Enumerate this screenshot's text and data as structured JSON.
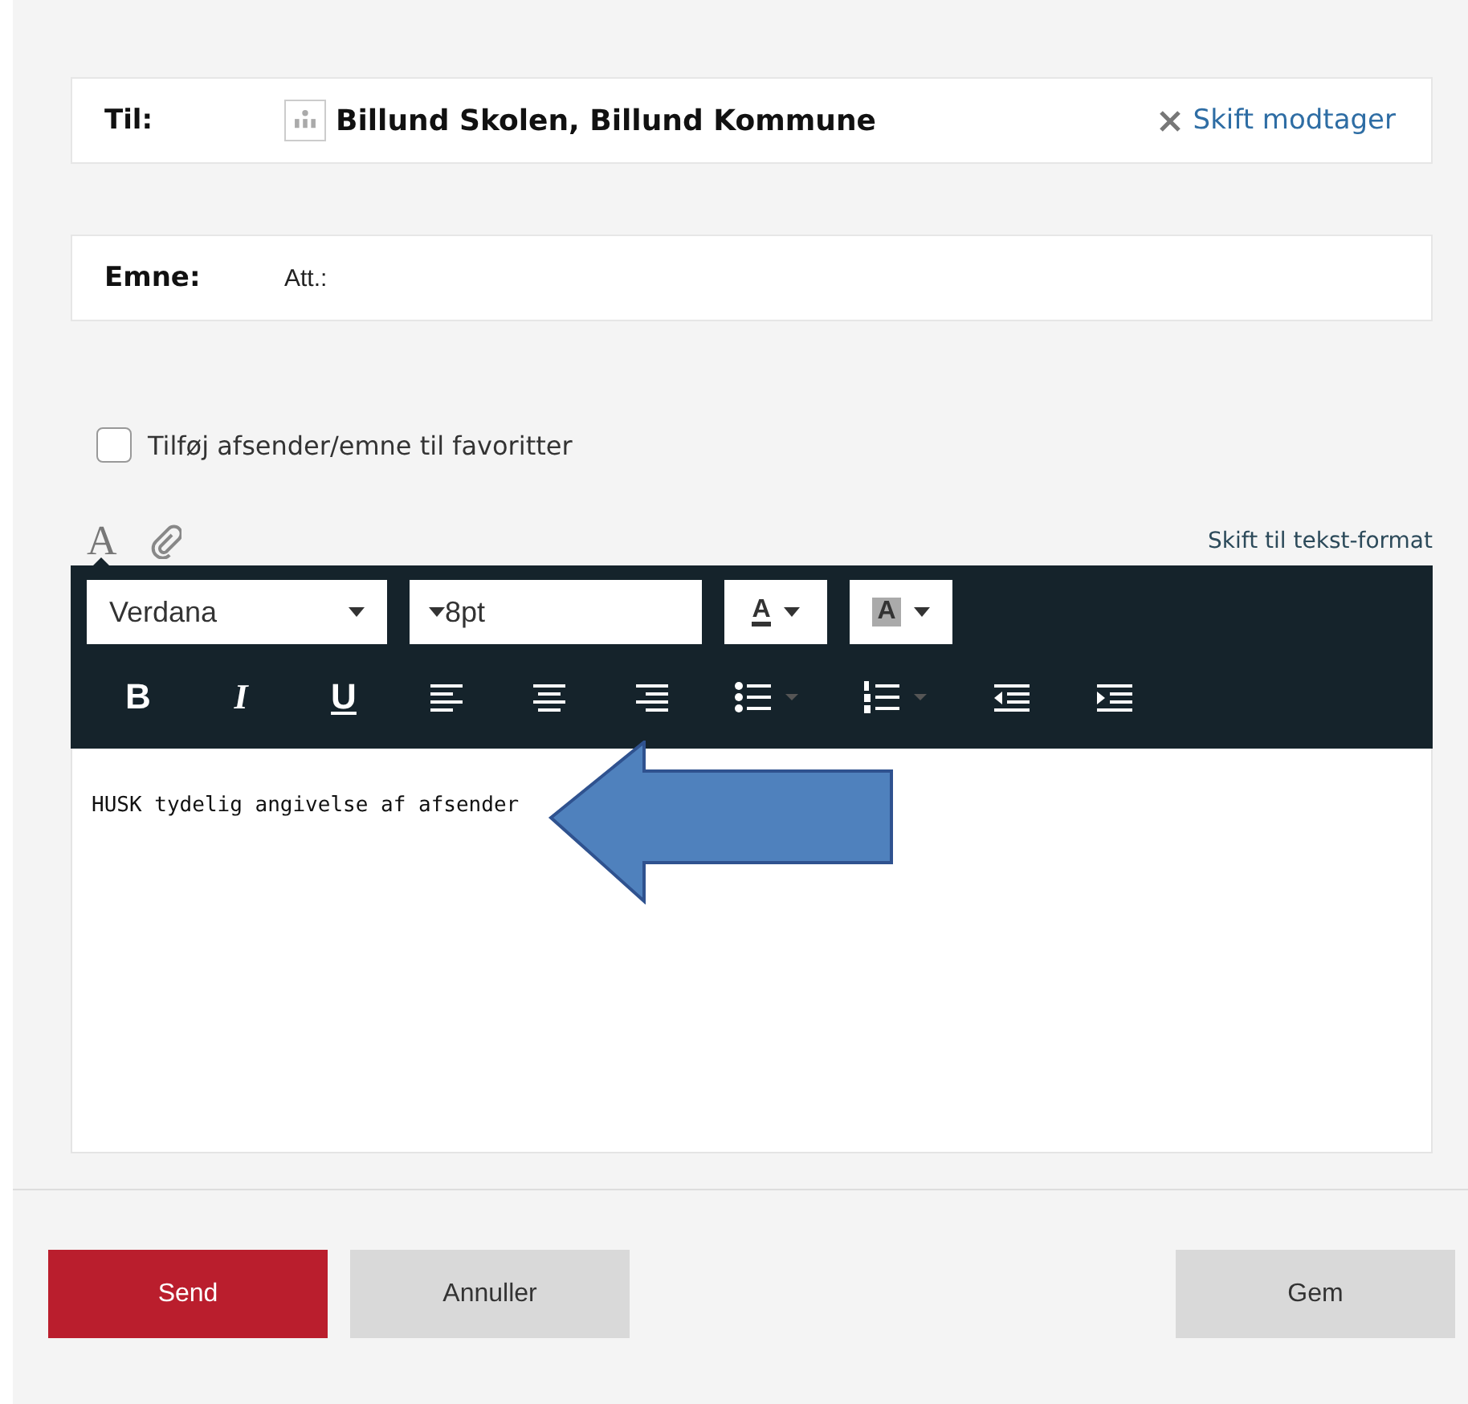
{
  "recipient": {
    "label": "Til:",
    "value": "Billund Skolen, Billund Kommune",
    "change_link": "Skift modtager"
  },
  "subject": {
    "label": "Emne:",
    "value": "Att.:"
  },
  "favorite": {
    "label": "Tilføj afsender/emne til favoritter",
    "checked": false
  },
  "editor_tabs": [
    {
      "kind": "format",
      "label": "A",
      "selected": true
    },
    {
      "kind": "attach",
      "selected": false
    }
  ],
  "switch_format_link": "Skift til tekst-format",
  "toolbar": {
    "font": "Verdana",
    "size": "8pt",
    "text_color": "A",
    "highlight_color": "A",
    "buttons": [
      {
        "kind": "bold",
        "label": "B"
      },
      {
        "kind": "italic",
        "label": "I"
      },
      {
        "kind": "underline",
        "label": "U"
      },
      {
        "kind": "align-left"
      },
      {
        "kind": "align-center"
      },
      {
        "kind": "align-right"
      },
      {
        "kind": "bullet-list"
      },
      {
        "kind": "numbered-list"
      },
      {
        "kind": "outdent"
      },
      {
        "kind": "indent"
      }
    ]
  },
  "body": "HUSK tydelig angivelse af afsender",
  "buttons": [
    {
      "kind": "primary",
      "label": "Send"
    },
    {
      "kind": "secondary",
      "label": "Annuller"
    },
    {
      "kind": "save",
      "label": "Gem"
    }
  ]
}
